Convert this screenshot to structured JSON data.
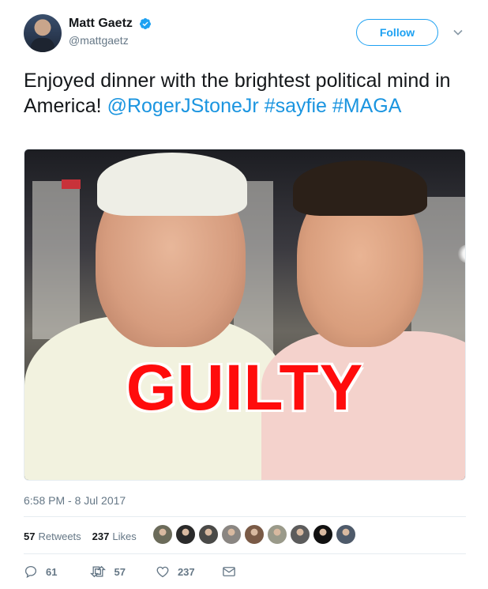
{
  "author": {
    "display_name": "Matt Gaetz",
    "handle": "@mattgaetz",
    "verified": true,
    "avatar_icon": "profile-photo"
  },
  "follow_button": {
    "label": "Follow"
  },
  "menu": {
    "icon": "chevron-down-icon"
  },
  "tweet": {
    "text_plain": "Enjoyed dinner with the brightest political mind in America! ",
    "mention": "@RogerJStoneJr",
    "hashtag1": "#sayfie",
    "hashtag2": "#MAGA"
  },
  "media": {
    "overlay_text": "GUILTY",
    "overlay_color": "#ff0c0c"
  },
  "timestamp": "6:58 PM - 8 Jul 2017",
  "stats": {
    "retweets_count": "57",
    "retweets_label": "Retweets",
    "likes_count": "237",
    "likes_label": "Likes"
  },
  "likers": [
    "#6b6b5a",
    "#2a2a2a",
    "#4a4a48",
    "#8a8682",
    "#7a5a46",
    "#9a9a8a",
    "#5c5c5c",
    "#111111",
    "#4e5a6a"
  ],
  "actions": {
    "reply_count": "61",
    "retweet_count": "57",
    "like_count": "237"
  },
  "colors": {
    "accent": "#1da1f2",
    "link": "#1b95e0",
    "muted": "#657786",
    "text": "#14171a"
  }
}
